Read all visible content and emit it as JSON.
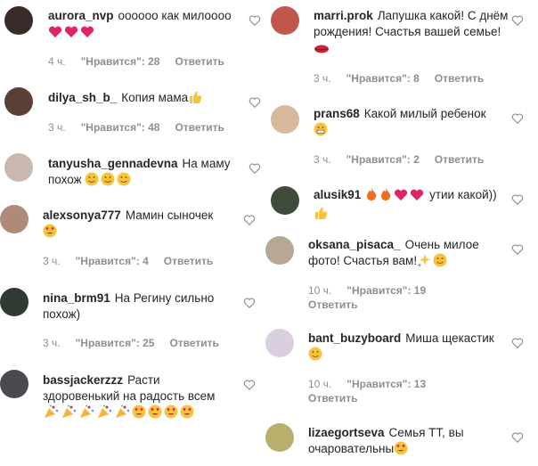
{
  "left": [
    {
      "user": "aurora_nvp",
      "text": "оооооо как милоооо",
      "emoji": [
        "heart",
        "heart",
        "heart"
      ],
      "time": "4 ч.",
      "likes": "\"Нравится\": 28",
      "reply": "Ответить",
      "avatar": "#3a2a2a"
    },
    {
      "user": "dilya_sh_b_",
      "text": "Копия мама",
      "emoji": [
        "thumb"
      ],
      "time": "3 ч.",
      "likes": "\"Нравится\": 48",
      "reply": "Ответить",
      "avatar": "#5a3f34"
    },
    {
      "user": "tanyusha_gennadevna",
      "text": "На маму похож",
      "emoji": [
        "hug",
        "hug",
        "hug"
      ],
      "time": "",
      "likes": "",
      "reply": "",
      "avatar": "#c9b8ad"
    },
    {
      "user": "alexsonya777",
      "text": "Мамин сыночек",
      "emoji": [
        "hearteyes"
      ],
      "time": "3 ч.",
      "likes": "\"Нравится\": 4",
      "reply": "Ответить",
      "avatar": "#b08a78"
    },
    {
      "user": "nina_brm91",
      "text": "На Регину сильно похож)",
      "emoji": [],
      "time": "3 ч.",
      "likes": "\"Нравится\": 25",
      "reply": "Ответить",
      "avatar": "#2f3a33"
    },
    {
      "user": "bassjackerzzz",
      "text": "Расти здоровенький на радость всем",
      "emoji": [
        "party",
        "party",
        "party",
        "party",
        "party",
        "hearteyes",
        "hearteyes",
        "hearteyes",
        "hearteyes"
      ],
      "time": "",
      "likes": "",
      "reply": "",
      "avatar": "#4a4a50"
    }
  ],
  "right": [
    {
      "user": "marri.prok",
      "text": "Лапушка какой! С днём рождения! Счастья вашей семье!",
      "emoji": [
        "kiss"
      ],
      "time": "3 ч.",
      "likes": "\"Нравится\": 8",
      "reply": "Ответить",
      "avatar": "#c0574a"
    },
    {
      "user": "prans68",
      "text": "Какой милый ребенок",
      "emoji": [
        "grin"
      ],
      "time": "3 ч.",
      "likes": "\"Нравится\": 2",
      "reply": "Ответить",
      "avatar": "#d6b89b"
    },
    {
      "user": "alusik91",
      "text": "утии какой))",
      "emoji": [
        "fire",
        "fire",
        "heart",
        "heart"
      ],
      "emoji2": [
        "thumb"
      ],
      "time": "",
      "likes": "",
      "reply": "",
      "avatar": "#3e4a3a"
    },
    {
      "user": "oksana_pisaca_",
      "text": "Очень милое фото! Счастья вам!",
      "emoji": [
        "sparkle",
        "hug"
      ],
      "time": "10 ч.",
      "likes": "\"Нравится\": 19",
      "reply": "Ответить",
      "avatar": "#b7a896"
    },
    {
      "user": "bant_buzyboard",
      "text": "Миша щекастик",
      "emoji": [
        "hug"
      ],
      "time": "10 ч.",
      "likes": "\"Нравится\": 13",
      "reply": "Ответить",
      "avatar": "#d9cfe1"
    },
    {
      "user": "lizaegortseva",
      "text": "Семья ТТ, вы очаровательны",
      "emoji": [
        "hearteyes"
      ],
      "time": "",
      "likes": "",
      "reply": "",
      "avatar": "#b7b06c"
    }
  ]
}
